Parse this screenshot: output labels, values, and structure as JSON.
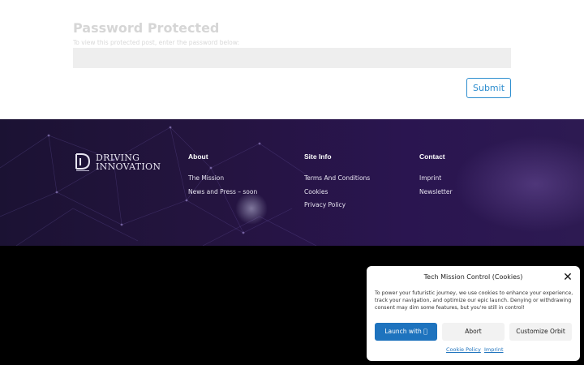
{
  "password_form": {
    "title": "Password Protected",
    "description": "To view this protected post, enter the password below:",
    "input_value": "",
    "submit_label": "Submit"
  },
  "footer": {
    "logo": {
      "line1": "DRIVING",
      "line2": "INNOVATION"
    },
    "columns": [
      {
        "title": "About",
        "links": [
          "The Mission",
          "News and Press – soon"
        ]
      },
      {
        "title": "Site Info",
        "links": [
          "Terms And Conditions",
          "Cookies",
          "Privacy Policy"
        ]
      },
      {
        "title": "Contact",
        "links": [
          "Imprint",
          "Newsletter"
        ]
      }
    ]
  },
  "cookie_banner": {
    "title": "Tech Mission Control (Cookies)",
    "close_icon": "close-icon",
    "text": "To power your futuristic journey, we use cookies to enhance your experience, track your navigation, and optimize our epic launch. Denying or withdrawing consent may dim some features, but you're still in control!",
    "accept_label": "Launch with ",
    "deny_label": "Abort",
    "customize_label": "Customize Orbit",
    "links": [
      "Cookie Policy",
      "Imprint"
    ]
  },
  "colors": {
    "accent": "#2e8ecf",
    "cookie_accept": "#1e73be",
    "footer_bg": "#24143f"
  }
}
